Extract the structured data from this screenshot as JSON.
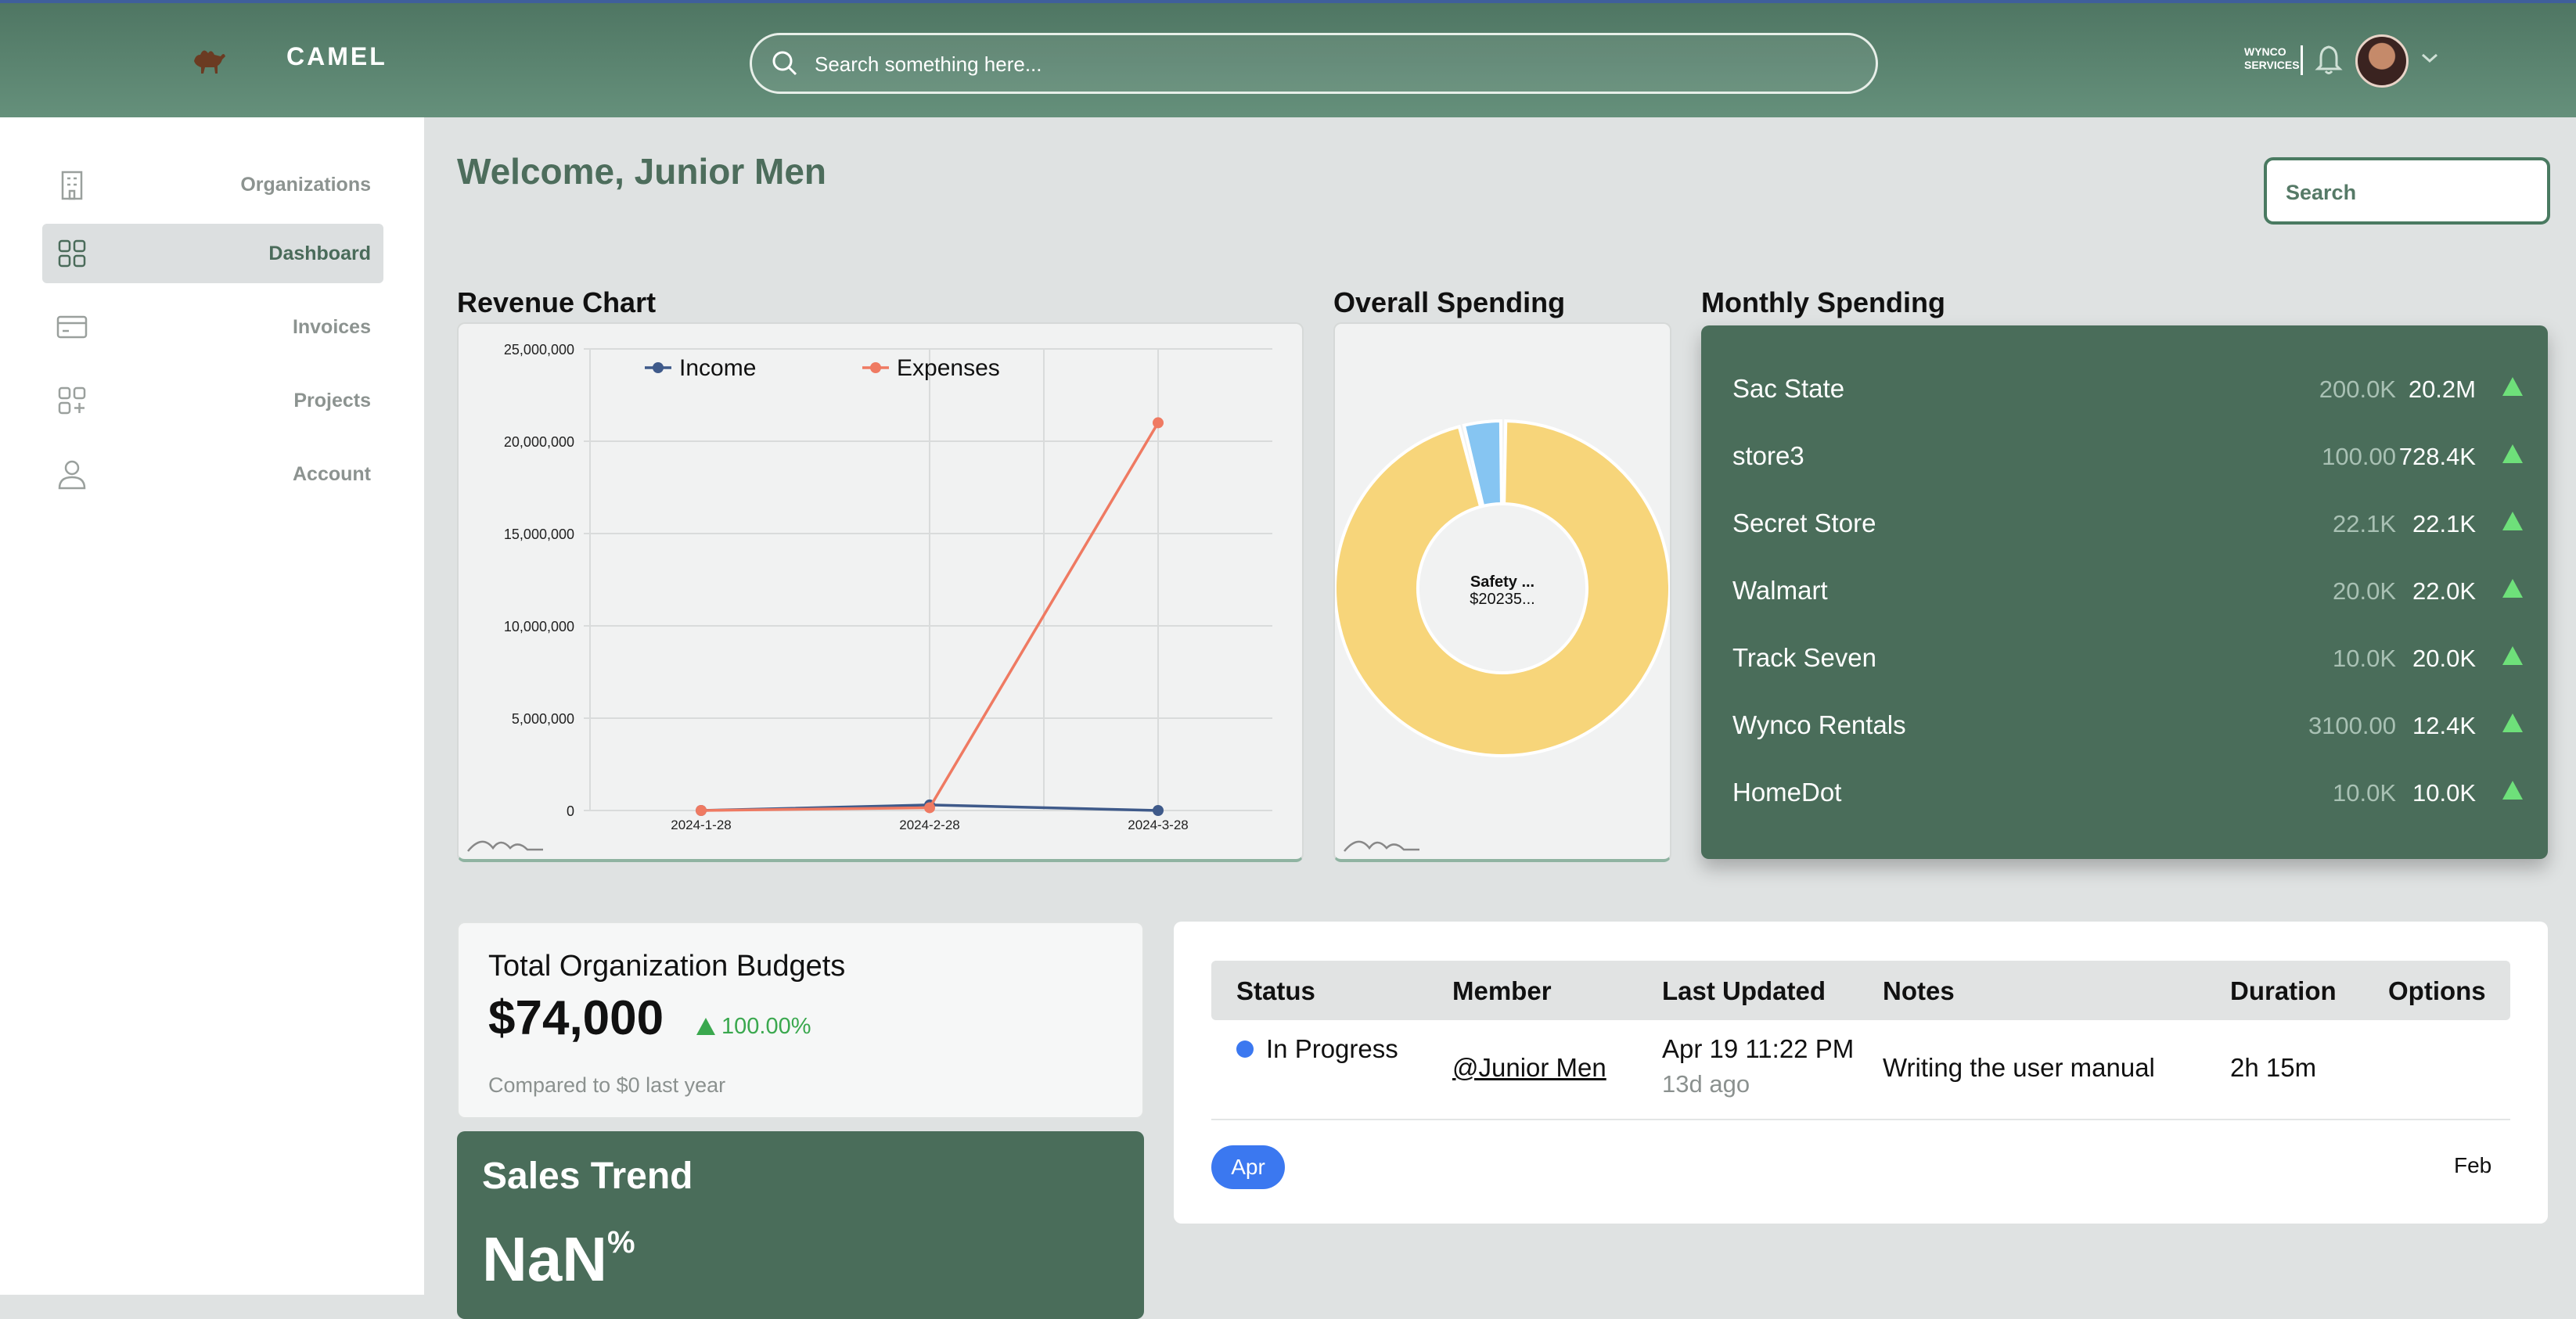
{
  "topbar": {
    "brand": "CAMEL",
    "search_placeholder": "Search something here...",
    "org_logo_text": "WYNCO SERVICES"
  },
  "sidebar": {
    "items": [
      {
        "label": "Organizations",
        "icon": "building-icon",
        "active": false
      },
      {
        "label": "Dashboard",
        "icon": "grid-icon",
        "active": true
      },
      {
        "label": "Invoices",
        "icon": "credit-card-icon",
        "active": false
      },
      {
        "label": "Projects",
        "icon": "add-grid-icon",
        "active": false
      },
      {
        "label": "Account",
        "icon": "user-icon",
        "active": false
      }
    ]
  },
  "main": {
    "welcome": "Welcome, Junior Men",
    "search_placeholder": "Search",
    "revenue_title": "Revenue Chart",
    "overall_title": "Overall Spending",
    "monthly_title": "Monthly Spending",
    "donut_label": "Safety ...",
    "donut_value": "$20235..."
  },
  "monthly_spending": [
    {
      "name": "Sac State",
      "previous": "200.0K",
      "current": "20.2M"
    },
    {
      "name": "store3",
      "previous": "100.00",
      "current": "728.4K"
    },
    {
      "name": "Secret Store",
      "previous": "22.1K",
      "current": "22.1K"
    },
    {
      "name": "Walmart",
      "previous": "20.0K",
      "current": "22.0K"
    },
    {
      "name": "Track Seven",
      "previous": "10.0K",
      "current": "20.0K"
    },
    {
      "name": "Wynco Rentals",
      "previous": "3100.00",
      "current": "12.4K"
    },
    {
      "name": "HomeDot",
      "previous": "10.0K",
      "current": "10.0K"
    }
  ],
  "budget": {
    "title": "Total Organization Budgets",
    "value": "$74,000",
    "change": "100.00%",
    "compare": "Compared to $0 last year"
  },
  "sales_trend": {
    "title": "Sales Trend",
    "value": "NaN",
    "unit": "%"
  },
  "tasks": {
    "headers": [
      "Status",
      "Member",
      "Last Updated",
      "Notes",
      "Duration",
      "Options"
    ],
    "row": {
      "status": "In Progress",
      "member": "@Junior Men",
      "updated": "Apr 19 11:22 PM",
      "ago": "13d ago",
      "notes": "Writing the user manual",
      "duration": "2h 15m"
    },
    "month_active": "Apr",
    "month_other": "Feb"
  },
  "colors": {
    "income": "#3f5a8a",
    "expenses": "#ef7a62",
    "donut_main": "#f7d57a",
    "donut_minor": "#86c5f2",
    "accent_green": "#4a6d5a"
  },
  "chart_data": [
    {
      "type": "line",
      "title": "Revenue Chart",
      "categories": [
        "2024-1-28",
        "2024-2-28",
        "2024-3-28"
      ],
      "series": [
        {
          "name": "Income",
          "values": [
            0,
            300000,
            0
          ]
        },
        {
          "name": "Expenses",
          "values": [
            0,
            150000,
            21000000
          ]
        }
      ],
      "ylim": [
        0,
        25000000
      ],
      "yticks": [
        "0",
        "5,000,000",
        "10,000,000",
        "15,000,000",
        "20,000,000",
        "25,000,000"
      ],
      "legend": "top"
    },
    {
      "type": "pie",
      "title": "Overall Spending",
      "slices": [
        {
          "label": "Safety ...",
          "value": 96
        },
        {
          "label": "",
          "value": 4
        }
      ]
    }
  ]
}
